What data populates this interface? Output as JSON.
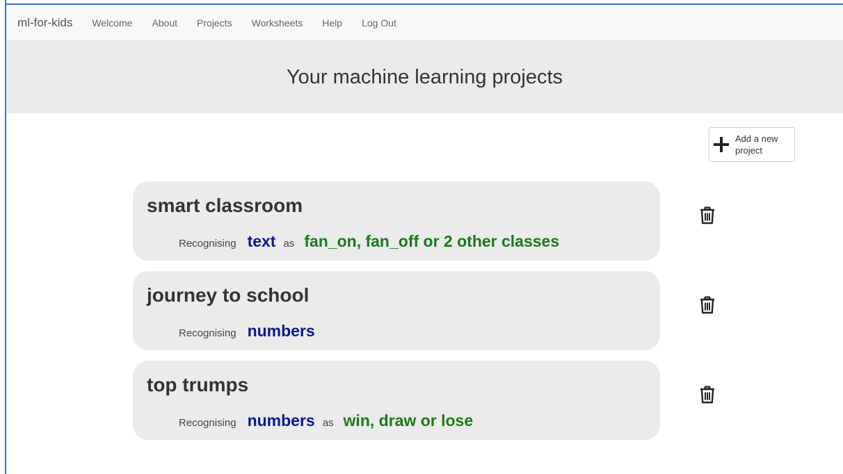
{
  "nav": {
    "brand": "ml-for-kids",
    "links": [
      "Welcome",
      "About",
      "Projects",
      "Worksheets",
      "Help",
      "Log Out"
    ]
  },
  "header": {
    "title": "Your machine learning projects"
  },
  "add_button": {
    "label": "Add a new project"
  },
  "projects": [
    {
      "name": "smart classroom",
      "recognising_label": "Recognising",
      "type": "text",
      "as_label": "as",
      "classes": "fan_on, fan_off or 2 other classes"
    },
    {
      "name": "journey to school",
      "recognising_label": "Recognising",
      "type": "numbers"
    },
    {
      "name": "top trumps",
      "recognising_label": "Recognising",
      "type": "numbers",
      "as_label": "as",
      "classes": "win, draw or lose"
    }
  ],
  "colors": {
    "type_color": "#0b1a8f",
    "classes_color": "#1a7a1a",
    "card_bg": "#ebebeb"
  },
  "icons": {
    "add": "plus-icon",
    "delete": "trash-icon"
  }
}
